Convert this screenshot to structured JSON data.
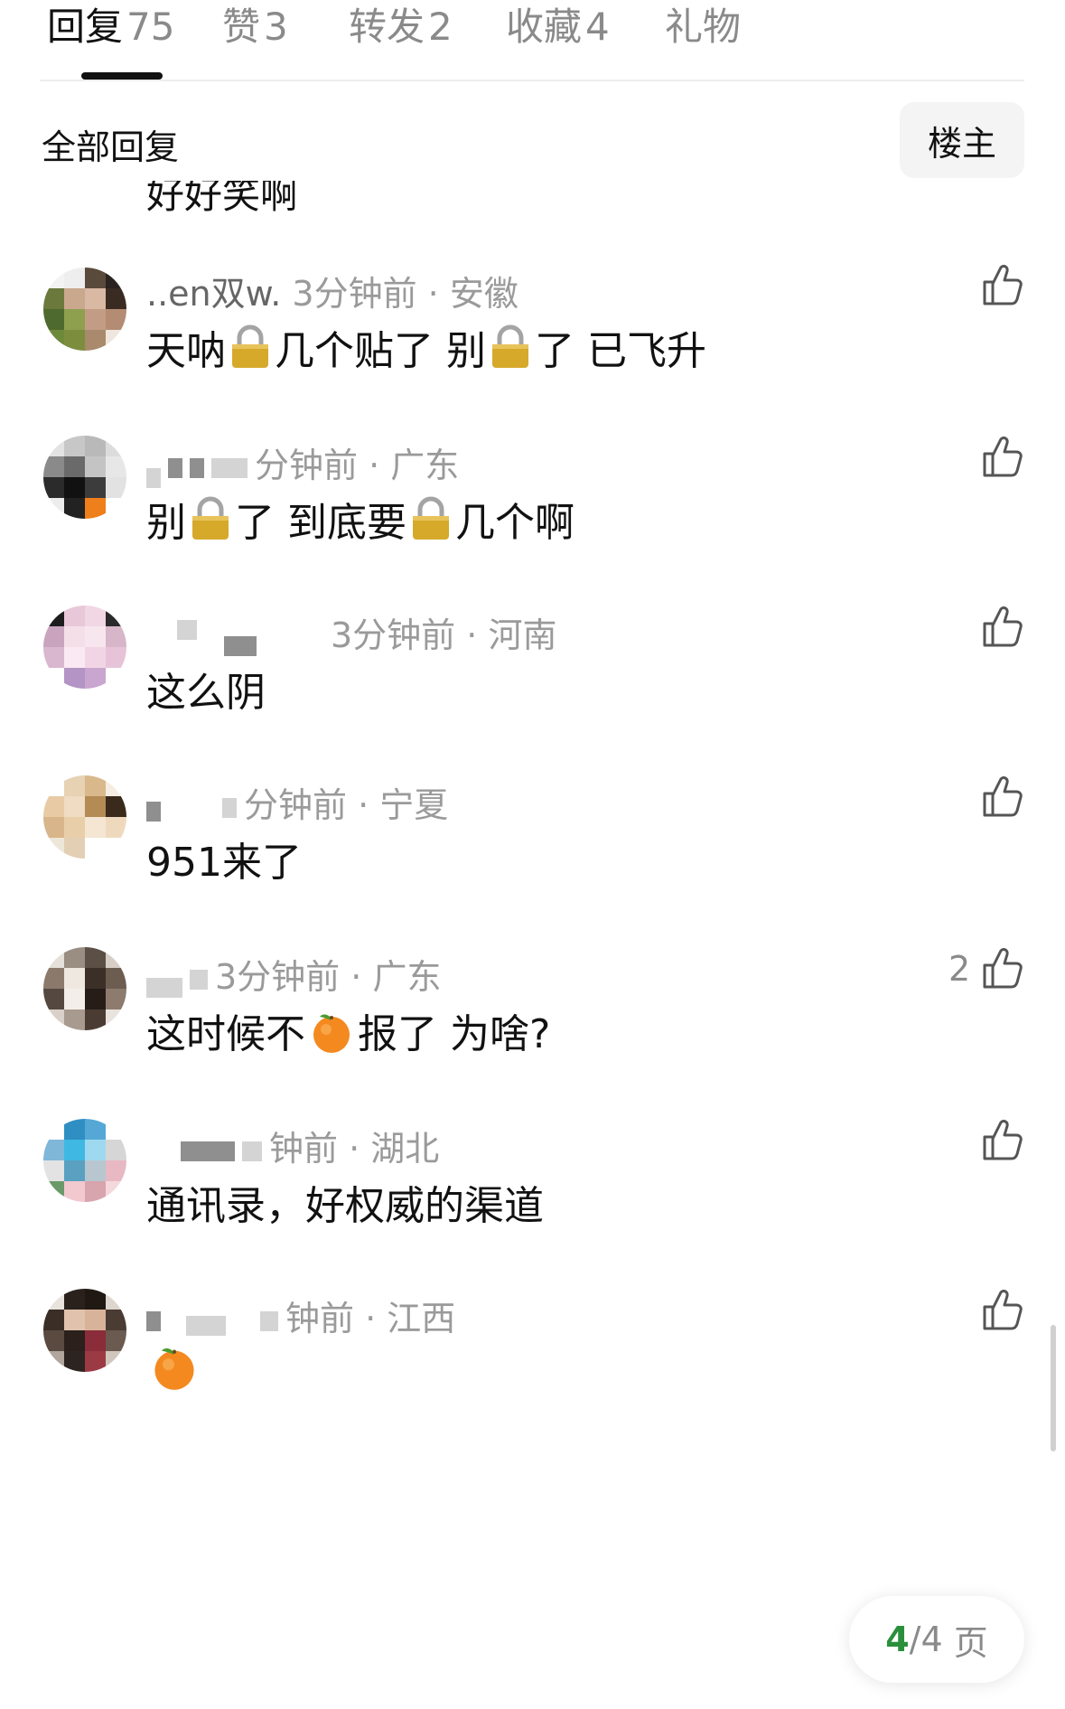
{
  "tabs": [
    {
      "label": "回复",
      "count": "75"
    },
    {
      "label": "赞",
      "count": "3"
    },
    {
      "label": "转发",
      "count": "2"
    },
    {
      "label": "收藏",
      "count": "4"
    },
    {
      "label": "礼物",
      "count": ""
    }
  ],
  "section": {
    "title": "全部回复",
    "owner_filter": "楼主"
  },
  "clipped_comment": {
    "text": "好好笑啊"
  },
  "comments": [
    {
      "name_visible": "..en双w.",
      "time": "3分钟前",
      "location": "安徽",
      "pre": "天呐",
      "mid": "几个贴了 别",
      "post": "了 已飞升",
      "likes": ""
    },
    {
      "name_visible": "",
      "time": "分钟前",
      "location": "广东",
      "pre": "别",
      "mid": "了 到底要",
      "post": "几个啊",
      "likes": ""
    },
    {
      "name_visible": "",
      "time": "3分钟前",
      "location": "河南",
      "text": "这么阴",
      "likes": ""
    },
    {
      "name_visible": "",
      "time": "分钟前",
      "location": "宁夏",
      "text": "951来了",
      "likes": ""
    },
    {
      "name_visible": "",
      "time": "3分钟前",
      "location": "广东",
      "pre": "这时候不",
      "post": "报了 为啥?",
      "likes": "2"
    },
    {
      "name_visible": "",
      "time": "钟前",
      "location": "湖北",
      "text": "通讯录，好权威的渠道",
      "likes": ""
    },
    {
      "name_visible": "",
      "time": "钟前",
      "location": "江西",
      "text": "",
      "likes": ""
    }
  ],
  "pager": {
    "current": "4",
    "total": "/4",
    "unit": "页"
  },
  "icons": {
    "like": "thumbs-up-icon",
    "lock": "lock-emoji",
    "orange": "tangerine-emoji"
  }
}
